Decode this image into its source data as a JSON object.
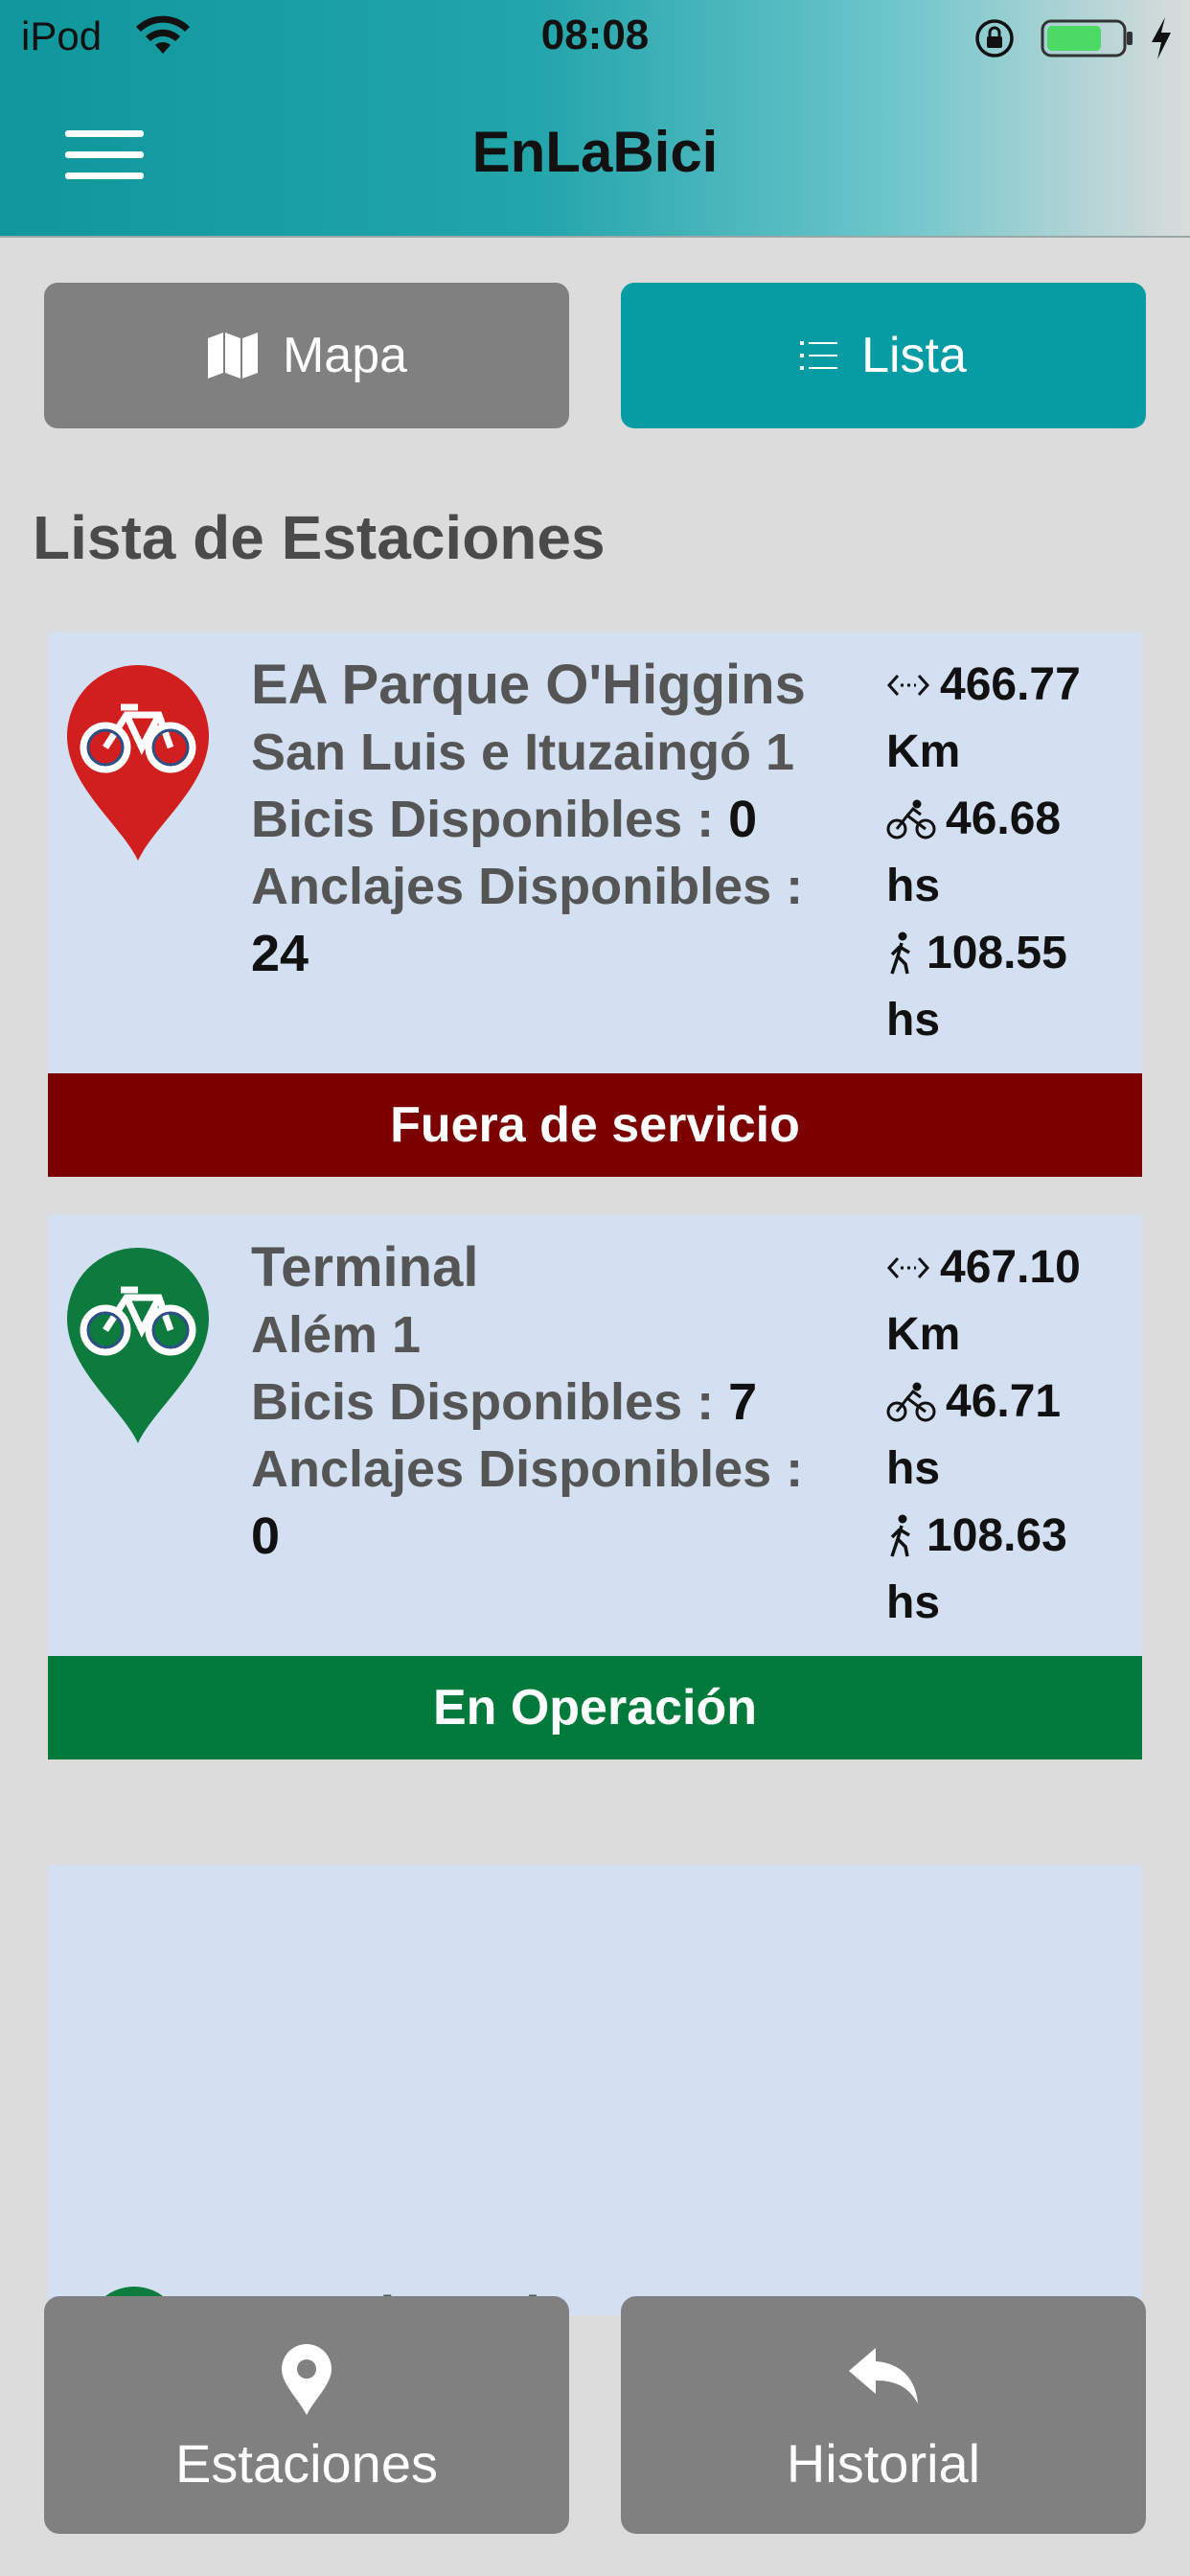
{
  "status_bar": {
    "carrier": "iPod",
    "time": "08:08"
  },
  "header": {
    "title": "EnLaBici"
  },
  "toggle": {
    "map_label": "Mapa",
    "list_label": "Lista"
  },
  "section_title": "Lista de Estaciones",
  "stations": [
    {
      "name": "EA Parque O'Higgins",
      "address": "San Luis e Ituzaingó 1",
      "bikes_label": "Bicis Disponibles :",
      "bikes_value": "0",
      "docks_label": "Anclajes Disponibles :",
      "docks_value": "24",
      "distance_value": "466.77",
      "distance_unit": "Km",
      "bike_time_value": "46.68",
      "bike_time_unit": "hs",
      "walk_time_value": "108.55",
      "walk_time_unit": "hs",
      "status": "Fuera de servicio",
      "pin_color": "#d11f1f",
      "status_color": "#7b0000"
    },
    {
      "name": "Terminal",
      "address": "Além 1",
      "bikes_label": "Bicis Disponibles :",
      "bikes_value": "7",
      "docks_label": "Anclajes Disponibles :",
      "docks_value": "0",
      "distance_value": "467.10",
      "distance_unit": "Km",
      "bike_time_value": "46.71",
      "bike_time_unit": "hs",
      "walk_time_value": "108.63",
      "walk_time_unit": "hs",
      "status": "En Operación",
      "pin_color": "#0d7a3e",
      "status_color": "#007a3b"
    },
    {
      "name_partial": "EA Alameda"
    }
  ],
  "bottom_nav": {
    "stations_label": "Estaciones",
    "history_label": "Historial"
  },
  "colors": {
    "accent": "#079ba3",
    "button_gray": "#808080",
    "card_bg": "#d3e0f1",
    "page_bg": "#dcdcdc"
  }
}
